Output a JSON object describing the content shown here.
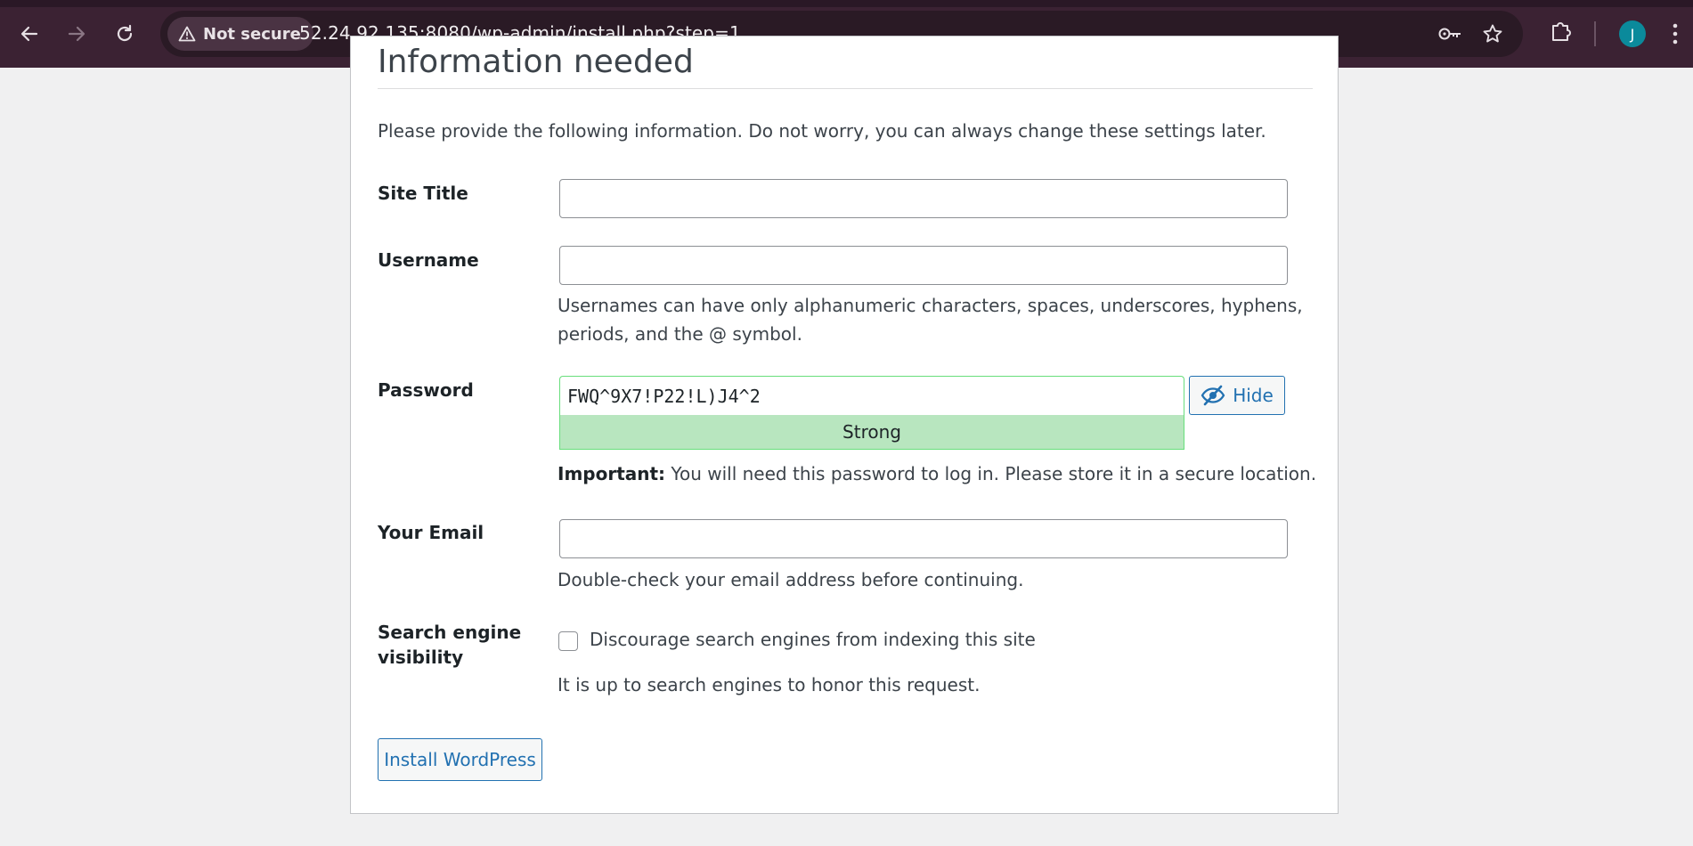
{
  "browser": {
    "security_label": "Not secure",
    "url": "52.24.92.135:8080/wp-admin/install.php?step=1",
    "avatar_initial": "J",
    "avatar_color": "#0b8a9b",
    "chrome_color": "#3b2233"
  },
  "page": {
    "heading": "Information needed",
    "intro": "Please provide the following information. Do not worry, you can always change these settings later.",
    "site_title": {
      "label": "Site Title",
      "value": ""
    },
    "username": {
      "label": "Username",
      "value": "",
      "description_line1": "Usernames can have only alphanumeric characters, spaces, underscores, hyphens,",
      "description_line2": "periods, and the @ symbol."
    },
    "password": {
      "label": "Password",
      "value": "FWQ^9X7!P22!L)J4^2",
      "strength": "Strong",
      "hide_label": "Hide",
      "important_label": "Important:",
      "important_text": " You will need this password to log in. Please store it in a secure location."
    },
    "email": {
      "label": "Your Email",
      "value": "",
      "description": "Double-check your email address before continuing."
    },
    "search_visibility": {
      "label_line1": "Search engine",
      "label_line2": "visibility",
      "checkbox_label": "Discourage search engines from indexing this site",
      "checked": false,
      "note": "It is up to search engines to honor this request."
    },
    "install_button": "Install WordPress",
    "accent_color": "#2271b1",
    "strength_color": "#b8e6bf"
  }
}
